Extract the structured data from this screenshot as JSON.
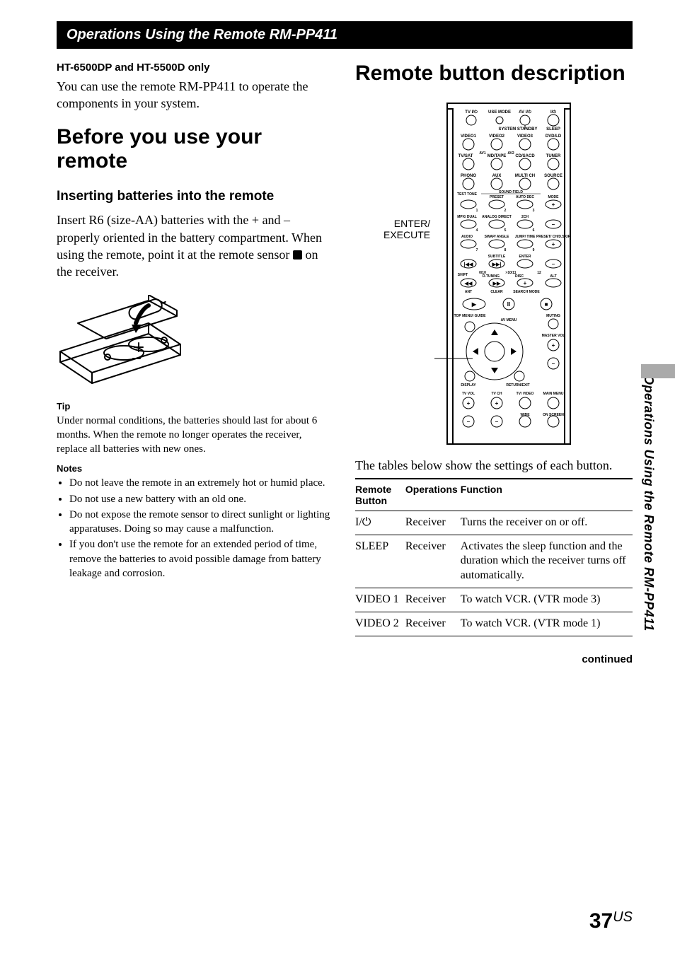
{
  "header": {
    "title": "Operations Using the Remote RM-PP411"
  },
  "left": {
    "model_note_title": "HT-6500DP and HT-5500D only",
    "model_note_body": "You can use the remote RM-PP411 to operate the components in your system.",
    "before_heading": "Before you use your remote",
    "insert_heading": "Inserting batteries into the remote",
    "insert_body_a": "Insert R6 (size-AA) batteries with the + and – properly oriented in the battery compartment. When using the remote, point it at the remote sensor ",
    "insert_body_b": " on the receiver.",
    "tip_label": "Tip",
    "tip_body": "Under normal conditions, the batteries should last for about 6 months. When the remote no longer operates the receiver, replace all batteries with new ones.",
    "notes_label": "Notes",
    "notes": [
      "Do not leave the remote in an extremely hot or humid place.",
      "Do not use a new battery with an old one.",
      "Do not expose the remote sensor to direct sunlight or lighting apparatuses. Doing so may cause a malfunction.",
      "If you don't use the remote for an extended period of time, remove the batteries to avoid possible damage from battery leakage and corrosion."
    ]
  },
  "right": {
    "remote_heading": "Remote button description",
    "diagram_caption_a": "ENTER/",
    "diagram_caption_b": "EXECUTE",
    "diagram_labels": {
      "row1": [
        "TV I/⏻",
        "USE MODE",
        "AV I/⏻",
        "I/⏻"
      ],
      "row1b": [
        "SYSTEM STANDBY",
        "SLEEP"
      ],
      "row2": [
        "VIDEO1",
        "VIDEO2",
        "VIDEO3",
        "DVD/LD"
      ],
      "row3": [
        "TV/SAT",
        "AV1",
        "MD/TAPE",
        "AV2",
        "CD/SACD",
        "TUNER"
      ],
      "row4": [
        "PHONO",
        "AUX",
        "MULTI CH",
        "SOURCE"
      ],
      "row5": [
        "TEST TONE",
        "SOUND FIELD",
        "PRESET",
        "AUTO DEC",
        "MODE"
      ],
      "row6": [
        "1",
        "2",
        "3",
        "+"
      ],
      "row7": [
        "MPX/ DUAL",
        "ANALOG DIRECT",
        "2CH"
      ],
      "row8": [
        "4",
        "5",
        "6",
        "–"
      ],
      "row9": [
        "AUDIO",
        "SWAP/ ANGLE",
        "JUMP/ TIME",
        "PRESET/ CH/D.SKIP"
      ],
      "row10": [
        "7",
        "8",
        "9",
        "+"
      ],
      "row11": [
        "SUBTITLE",
        "ENTER"
      ],
      "row12": [
        "|◀◀",
        "▶▶|",
        "–"
      ],
      "row13": [
        "SHIFT",
        "0/10",
        "D.TUNING",
        ">10/11",
        "DISC",
        "12",
        "ALT"
      ],
      "row14": [
        "◀◀",
        "▶▶",
        "+"
      ],
      "row15": [
        "ANT",
        "CLEAR",
        "SEARCH MODE"
      ],
      "row16": [
        "▶",
        "II",
        "■"
      ],
      "row17": [
        "TOP MENU/ GUIDE",
        "AV MENU",
        "MUTING"
      ],
      "row18": [
        "MASTER VOL",
        "+",
        "–"
      ],
      "row19": [
        "DISPLAY",
        "RETURN/EXIT"
      ],
      "row20": [
        "TV VOL",
        "TV CH",
        "TV/ VIDEO",
        "MAIN MENU"
      ],
      "row21": [
        "+",
        "+",
        "WIDE",
        "ON SCREEN"
      ],
      "row22": [
        "–",
        "–"
      ]
    },
    "table_lead": "The tables below show the settings of each button.",
    "table_headers": [
      "Remote Button",
      "Operations",
      "Function"
    ],
    "table_rows": [
      {
        "button": "I/⏻",
        "op": "Receiver",
        "fn": "Turns the receiver on or off."
      },
      {
        "button": "SLEEP",
        "op": "Receiver",
        "fn": "Activates the sleep function and the duration which the receiver turns off automatically."
      },
      {
        "button": "VIDEO 1",
        "op": "Receiver",
        "fn": "To watch VCR. (VTR mode 3)"
      },
      {
        "button": "VIDEO 2",
        "op": "Receiver",
        "fn": "To watch VCR. (VTR mode 1)"
      }
    ],
    "continued": "continued"
  },
  "side_tab": "Operations Using the Remote RM-PP411",
  "page_number": {
    "num": "37",
    "suffix": "US"
  }
}
